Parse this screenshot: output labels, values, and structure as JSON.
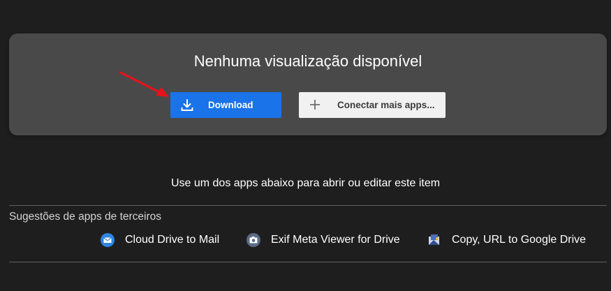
{
  "preview": {
    "title": "Nenhuma visualização disponível",
    "download_label": "Download",
    "connect_label": "Conectar mais apps..."
  },
  "open_with": {
    "prompt": "Use um dos apps abaixo para abrir ou editar este item"
  },
  "suggestions": {
    "title": "Sugestões de apps de terceiros",
    "apps": [
      {
        "name": "Cloud Drive to Mail",
        "icon": "mail-icon"
      },
      {
        "name": "Exif Meta Viewer for Drive",
        "icon": "camera-icon"
      },
      {
        "name": "Copy, URL to Google Drive",
        "icon": "copy-url-icon"
      }
    ]
  },
  "colors": {
    "background": "#1f1e1f",
    "card": "#4a494a",
    "primary_button": "#1a73e8",
    "secondary_button": "#f1f1f1",
    "annotation_arrow": "#e8121a"
  }
}
